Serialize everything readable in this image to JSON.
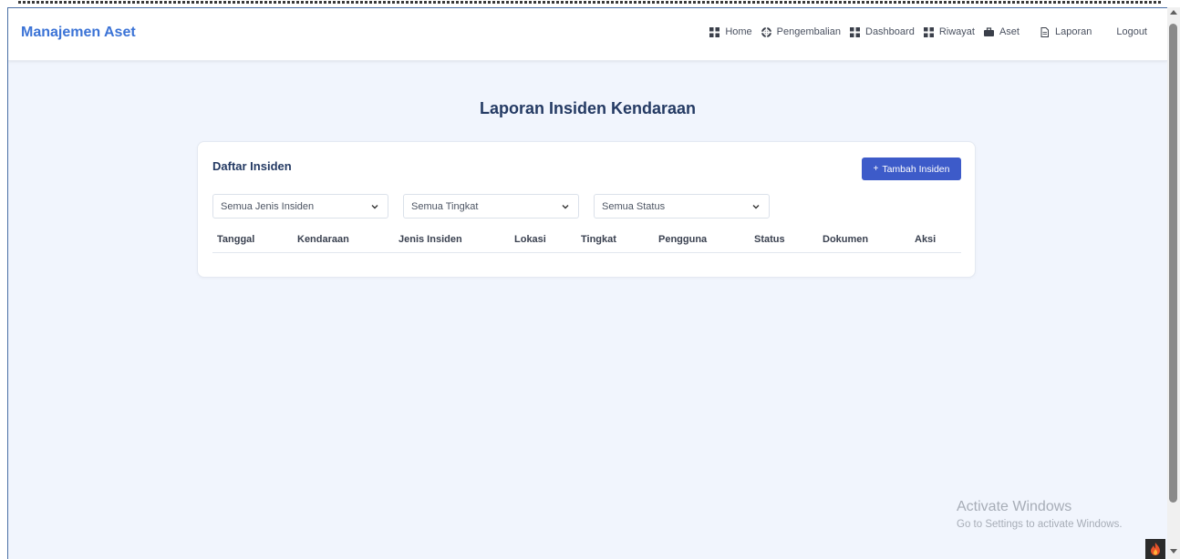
{
  "app": {
    "title": "Manajemen Aset"
  },
  "nav": {
    "items": [
      {
        "label": "Home",
        "icon": "grid-icon"
      },
      {
        "label": "Pengembalian",
        "icon": "lifebuoy-icon"
      },
      {
        "label": "Dashboard",
        "icon": "grid-icon"
      },
      {
        "label": "Riwayat",
        "icon": "grid-icon"
      },
      {
        "label": "Aset",
        "icon": "briefcase-icon"
      },
      {
        "label": "Laporan",
        "icon": "document-icon"
      }
    ],
    "logout_label": "Logout"
  },
  "page": {
    "title": "Laporan Insiden Kendaraan"
  },
  "card": {
    "title": "Daftar Insiden",
    "add_button_label": "Tambah Insiden",
    "filters": {
      "jenis": "Semua Jenis Insiden",
      "tingkat": "Semua Tingkat",
      "status": "Semua Status"
    },
    "columns": [
      "Tanggal",
      "Kendaraan",
      "Jenis Insiden",
      "Lokasi",
      "Tingkat",
      "Pengguna",
      "Status",
      "Dokumen",
      "Aksi"
    ]
  },
  "watermark": {
    "line1": "Activate Windows",
    "line2": "Go to Settings to activate Windows."
  },
  "colors": {
    "brand": "#3b73d6",
    "primary_button": "#3d5bc9",
    "page_background": "#f1f5fd",
    "heading": "#243a63"
  }
}
